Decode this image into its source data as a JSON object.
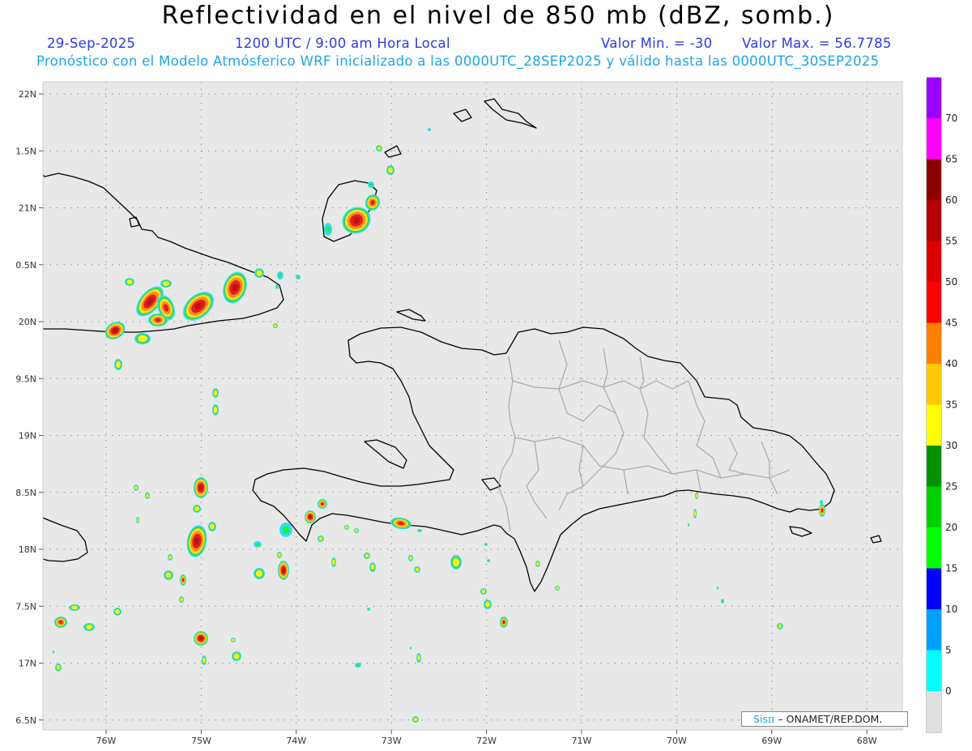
{
  "header": {
    "title": "Reflectividad en el nivel de 850 mb (dBZ, somb.)",
    "date": "29-Sep-2025",
    "time": "1200 UTC / 9:00 am Hora Local",
    "min_label": "Valor Min. = -30",
    "max_label": "Valor Max. = 56.7785",
    "subtitle": "Pronóstico con el Modelo Atmósferico WRF inicializado a las 0000UTC_28SEP2025 y válido hasta las  0000UTC_30SEP2025"
  },
  "map": {
    "lon_range": [
      -76.8,
      -67.5
    ],
    "lat_range": [
      16.4,
      22.1
    ],
    "lat_ticks": [
      {
        "value": 22.0,
        "label": "22N"
      },
      {
        "value": 21.5,
        "label": "1.5N"
      },
      {
        "value": 21.0,
        "label": "21N"
      },
      {
        "value": 20.5,
        "label": "0.5N"
      },
      {
        "value": 20.0,
        "label": "20N"
      },
      {
        "value": 19.5,
        "label": "9.5N"
      },
      {
        "value": 19.0,
        "label": "19N"
      },
      {
        "value": 18.5,
        "label": "8.5N"
      },
      {
        "value": 18.0,
        "label": "18N"
      },
      {
        "value": 17.5,
        "label": "7.5N"
      },
      {
        "value": 17.0,
        "label": "17N"
      },
      {
        "value": 16.5,
        "label": "6.5N"
      }
    ],
    "lon_ticks": [
      {
        "value": -76,
        "label": "76W"
      },
      {
        "value": -75,
        "label": "75W"
      },
      {
        "value": -74,
        "label": "74W"
      },
      {
        "value": -73,
        "label": "73W"
      },
      {
        "value": -72,
        "label": "72W"
      },
      {
        "value": -71,
        "label": "71W"
      },
      {
        "value": -70,
        "label": "70W"
      },
      {
        "value": -69,
        "label": "69W"
      },
      {
        "value": -68,
        "label": "68W"
      }
    ],
    "grid": "dotted",
    "ocean_color": "#e8e8e8",
    "coast_color": "#000000",
    "province_color": "#a8a8a8"
  },
  "colorbar": {
    "labels": [
      "0",
      "5",
      "10",
      "15",
      "20",
      "25",
      "30",
      "35",
      "40",
      "45",
      "50",
      "55",
      "60",
      "65",
      "70"
    ],
    "colors": [
      "#00ffff",
      "#00a0ff",
      "#0000ff",
      "#00ff00",
      "#00d000",
      "#009000",
      "#ffff00",
      "#ffc800",
      "#ff8000",
      "#ff0000",
      "#dc0000",
      "#b40000",
      "#8c0000",
      "#ff00ff",
      "#9a00ff"
    ]
  },
  "credit": {
    "sis": "Sis",
    "pi": "π",
    "org": "– ONAMET/REP.DOM."
  }
}
